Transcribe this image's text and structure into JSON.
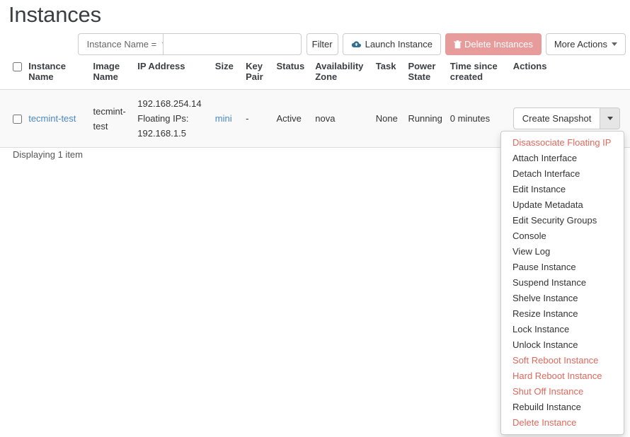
{
  "page": {
    "title": "Instances"
  },
  "toolbar": {
    "filter_select": {
      "label": "Instance Name =",
      "icon": "chevron-down-icon"
    },
    "search": {
      "value": "",
      "placeholder": ""
    },
    "filter_button": "Filter",
    "launch_button": {
      "label": "Launch Instance",
      "icon": "cloud-upload-icon"
    },
    "delete_button": {
      "label": "Delete Instances",
      "icon": "trash-icon",
      "bg": "#e79b9b",
      "fg": "#ffffff"
    },
    "more_actions_button": {
      "label": "More Actions",
      "icon": "chevron-down-icon"
    }
  },
  "table": {
    "columns": [
      "",
      "Instance Name",
      "Image Name",
      "IP Address",
      "Size",
      "Key Pair",
      "Status",
      "Availability Zone",
      "Task",
      "Power State",
      "Time since created",
      "Actions"
    ],
    "rows": [
      {
        "instance_name": "tecmint-test",
        "image_name": "tecmint-test",
        "ip_primary": "192.168.254.14",
        "ip_floating_label": "Floating IPs:",
        "ip_floating": "192.168.1.5",
        "size": "mini",
        "key_pair": "-",
        "status": "Active",
        "availability_zone": "nova",
        "task": "None",
        "power_state": "Running",
        "time_since_created": "0 minutes",
        "action_primary": "Create Snapshot"
      }
    ]
  },
  "dropdown": {
    "items": [
      {
        "label": "Disassociate Floating IP",
        "danger": true
      },
      {
        "label": "Attach Interface",
        "danger": false
      },
      {
        "label": "Detach Interface",
        "danger": false
      },
      {
        "label": "Edit Instance",
        "danger": false
      },
      {
        "label": "Update Metadata",
        "danger": false
      },
      {
        "label": "Edit Security Groups",
        "danger": false
      },
      {
        "label": "Console",
        "danger": false
      },
      {
        "label": "View Log",
        "danger": false
      },
      {
        "label": "Pause Instance",
        "danger": false
      },
      {
        "label": "Suspend Instance",
        "danger": false
      },
      {
        "label": "Shelve Instance",
        "danger": false
      },
      {
        "label": "Resize Instance",
        "danger": false
      },
      {
        "label": "Lock Instance",
        "danger": false
      },
      {
        "label": "Unlock Instance",
        "danger": false
      },
      {
        "label": "Soft Reboot Instance",
        "danger": true
      },
      {
        "label": "Hard Reboot Instance",
        "danger": true
      },
      {
        "label": "Shut Off Instance",
        "danger": true
      },
      {
        "label": "Rebuild Instance",
        "danger": false
      },
      {
        "label": "Delete Instance",
        "danger": true
      }
    ],
    "danger_color": "#e0685b"
  },
  "footer": {
    "count_text": "Displaying 1 item"
  },
  "colors": {
    "link": "#4a88c7",
    "danger": "#e0685b",
    "row_bg": "#f9f9f9",
    "border": "#dddddd"
  }
}
